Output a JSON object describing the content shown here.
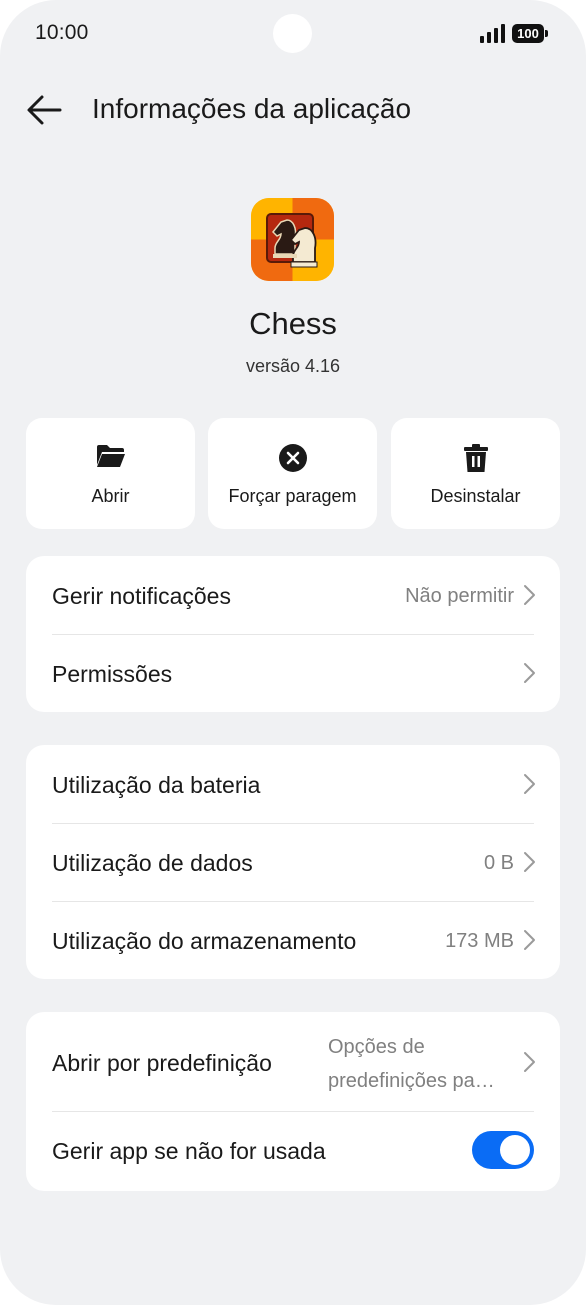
{
  "status_bar": {
    "time": "10:00",
    "battery": "100",
    "signal_icon": "signal-icon",
    "battery_icon": "battery-icon"
  },
  "header": {
    "back_icon": "back-arrow-icon",
    "title": "Informações da aplicação"
  },
  "app": {
    "icon": "chess-app-icon",
    "name": "Chess",
    "version": "versão 4.16"
  },
  "actions": [
    {
      "label": "Abrir",
      "icon": "folder-icon"
    },
    {
      "label": "Forçar paragem",
      "icon": "close-circle-icon"
    },
    {
      "label": "Desinstalar",
      "icon": "trash-icon"
    }
  ],
  "card1": {
    "rows": [
      {
        "label": "Gerir notificações",
        "value": "Não permitir"
      },
      {
        "label": "Permissões",
        "value": ""
      }
    ]
  },
  "card2": {
    "rows": [
      {
        "label": "Utilização da bateria",
        "value": ""
      },
      {
        "label": "Utilização de dados",
        "value": "0 B"
      },
      {
        "label": "Utilização do armazenamento",
        "value": "173 MB"
      }
    ]
  },
  "card3": {
    "rows": [
      {
        "label": "Abrir por predefinição",
        "value": "Opções de predefinições pa…"
      },
      {
        "label": "Gerir app se não for usada",
        "toggle_on": true
      }
    ]
  },
  "colors": {
    "background": "#f0f1f3",
    "card": "#ffffff",
    "accent": "#0a6cf5",
    "secondary_text": "#808080"
  }
}
